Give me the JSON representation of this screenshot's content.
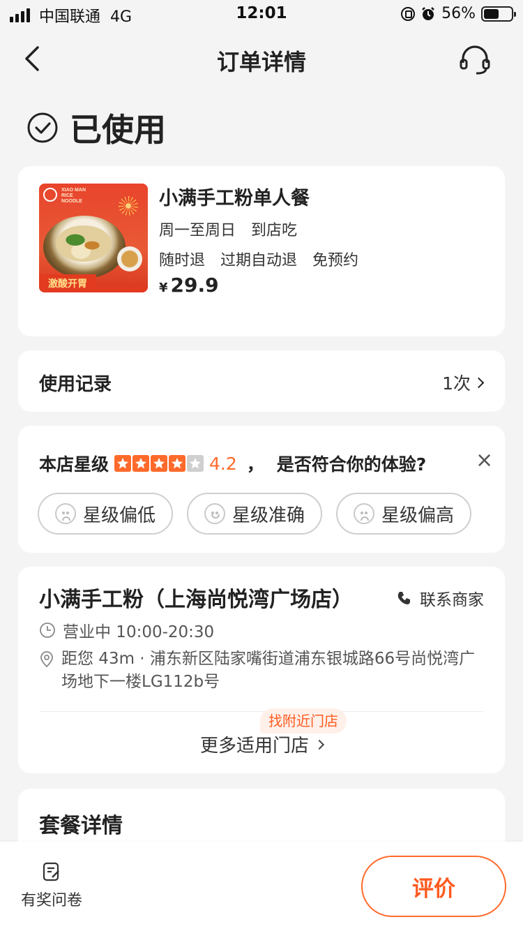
{
  "status_bar": {
    "carrier": "中国联通",
    "network": "4G",
    "time": "12:01",
    "battery": "56%",
    "battery_level": 0.56
  },
  "nav": {
    "title": "订单详情",
    "back_icon": "chevron-left-icon",
    "service_icon": "headset-icon"
  },
  "order_status": {
    "label": "已使用",
    "icon": "check-circle-icon"
  },
  "product": {
    "thumb_banner": "激酸开胃",
    "thumb_brand": "XIAO MAN RICE NOODLE",
    "name": "小满手工粉单人餐",
    "tags1": [
      "周一至周日",
      "到店吃"
    ],
    "tags2": [
      "随时退",
      "过期自动退",
      "免预约"
    ],
    "currency": "¥",
    "price": "29.9"
  },
  "usage": {
    "label": "使用记录",
    "count": "1次"
  },
  "rating": {
    "prefix": "本店星级",
    "stars": 4,
    "max_stars": 5,
    "score": "4.2",
    "separator": "，",
    "question": "是否符合你的体验?",
    "accent": "#ff6a2b",
    "options": [
      "星级偏低",
      "星级准确",
      "星级偏高"
    ]
  },
  "store": {
    "name": "小满手工粉（上海尚悦湾广场店）",
    "contact": "联系商家",
    "hours": "营业中 10:00-20:30",
    "address": "距您 43m · 浦东新区陆家嘴街道浦东银城路66号尚悦湾广场地下一楼LG112b号",
    "tag": "找附近门店",
    "more": "更多适用门店"
  },
  "package": {
    "title": "套餐详情"
  },
  "bottom": {
    "survey": "有奖问卷",
    "review": "评价"
  }
}
